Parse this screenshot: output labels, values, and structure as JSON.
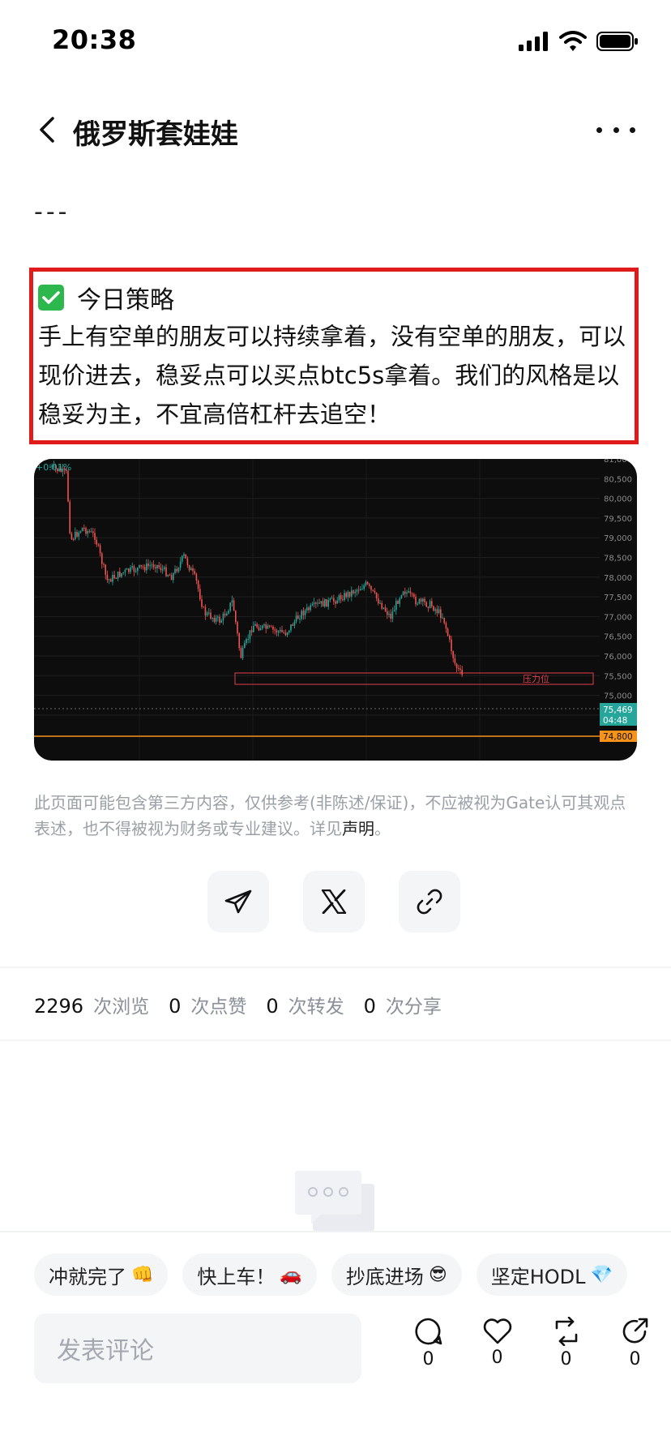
{
  "status_bar": {
    "time": "20:38"
  },
  "nav": {
    "title": "俄罗斯套娃娃"
  },
  "post": {
    "divider": "---",
    "strategy": {
      "title": "今日策略",
      "body": "手上有空单的朋友可以持续拿着，没有空单的朋友，可以现价进去，稳妥点可以买点btc5s拿着。我们的风格是以稳妥为主，不宜高倍杠杆去追空！"
    },
    "chart": {
      "change_label": "+0.01%",
      "y_labels": [
        "81,000",
        "80,500",
        "80,000",
        "79,500",
        "79,000",
        "78,500",
        "78,000",
        "77,500",
        "77,000",
        "76,500",
        "76,000",
        "75,500",
        "75,000",
        "74,500"
      ],
      "zone_label": "压力位",
      "price_tag": "75,469",
      "countdown_tag": "04:48",
      "level_tag": "74,800",
      "up_color": "#26a69a",
      "down_color": "#ef5350",
      "zone_color": "#e0404a",
      "level_color": "#f7931a"
    },
    "disclaimer": {
      "text": "此页面可能包含第三方内容，仅供参考(非陈述/保证)，不应被视为Gate认可其观点表述，也不得被视为财务或专业建议。详见",
      "link": "声明",
      "tail": "。"
    }
  },
  "share": {
    "icons": [
      "telegram-icon",
      "x-icon",
      "link-icon"
    ]
  },
  "stats": {
    "views": "2296",
    "views_label": "次浏览",
    "likes": "0",
    "likes_label": "次点赞",
    "reposts": "0",
    "reposts_label": "次转发",
    "shares": "0",
    "shares_label": "次分享"
  },
  "quick_replies": [
    {
      "text": "冲就完了",
      "emoji": "👊"
    },
    {
      "text": "快上车！",
      "emoji": "🚗"
    },
    {
      "text": "抄底进场",
      "emoji": "😎"
    },
    {
      "text": "坚定HODL",
      "emoji": "💎"
    }
  ],
  "comment": {
    "placeholder": "发表评论"
  },
  "actions": {
    "comments": "0",
    "likes": "0",
    "reposts": "0",
    "shares": "0"
  },
  "accent_color": "#e01b1b"
}
